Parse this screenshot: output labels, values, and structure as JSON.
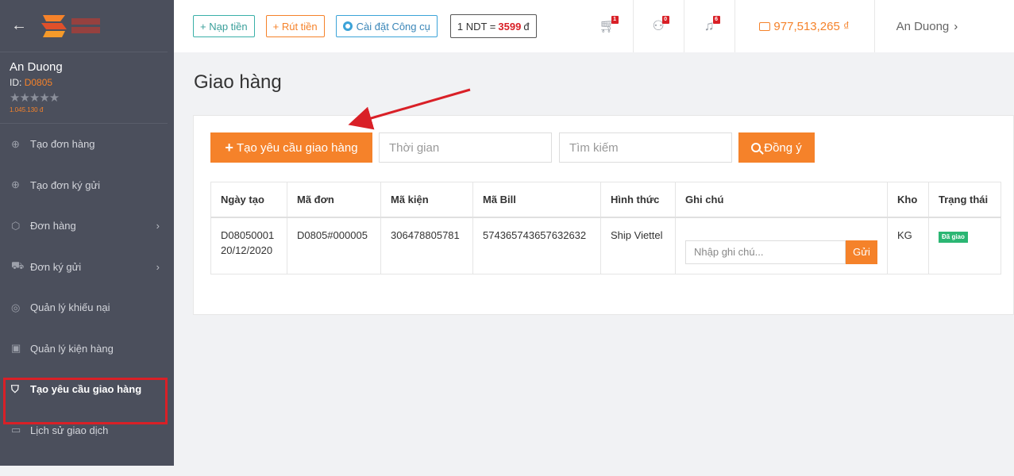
{
  "sidebar": {
    "user_name": "An Duong",
    "id_label": "ID:",
    "id_value": "D0805",
    "stars": "★★★★★",
    "balance": "1.045.130 đ",
    "items": [
      {
        "label": "Tạo đơn hàng",
        "icon": "plus-circle-icon"
      },
      {
        "label": "Tạo đơn ký gửi",
        "icon": "plus-circle-icon"
      },
      {
        "label": "Đơn hàng",
        "icon": "tag-icon"
      },
      {
        "label": "Đơn ký gửi",
        "icon": "truck-icon"
      },
      {
        "label": "Quản lý khiếu nại",
        "icon": "alert-icon"
      },
      {
        "label": "Quản lý kiện hàng",
        "icon": "package-icon"
      },
      {
        "label": "Tạo yêu cầu giao hàng",
        "icon": "cart-icon"
      },
      {
        "label": "Lịch sử giao dịch",
        "icon": "card-icon"
      }
    ]
  },
  "topbar": {
    "deposit_label": "+ Nạp tiền",
    "withdraw_label": "+ Rút tiền",
    "install_label": "Cài đặt Công cụ",
    "rate_prefix": "1 NDT =",
    "rate_value": "3599",
    "rate_suffix": "đ",
    "cart_badge": "1",
    "users_badge": "0",
    "bell_badge": "6",
    "balance": "977,513,265 ₫",
    "user_name": "An Duong"
  },
  "main": {
    "page_title": "Giao hàng",
    "create_button": "Tạo yêu cầu giao hàng",
    "time_placeholder": "Thời gian",
    "search_placeholder": "Tìm kiếm",
    "agree_button": "Đồng ý",
    "table": {
      "headers": [
        "Ngày tạo",
        "Mã đơn",
        "Mã kiện",
        "Mã Bill",
        "Hình thức",
        "Ghi chú",
        "Kho",
        "Trạng thái"
      ],
      "rows": [
        {
          "created_code": "D08050001",
          "created_date": "20/12/2020",
          "order_code": "D0805#000005",
          "package_code": "306478805781",
          "bill_code": "574365743657632632",
          "method": "Ship Viettel",
          "note_placeholder": "Nhập ghi chú...",
          "send_label": "Gửi",
          "warehouse": "KG",
          "status": "Đã giao"
        }
      ]
    }
  },
  "colors": {
    "accent": "#f5822a",
    "sidebar_bg": "#4b4f5c",
    "highlight": "#d92027",
    "status_green": "#2bb673"
  }
}
